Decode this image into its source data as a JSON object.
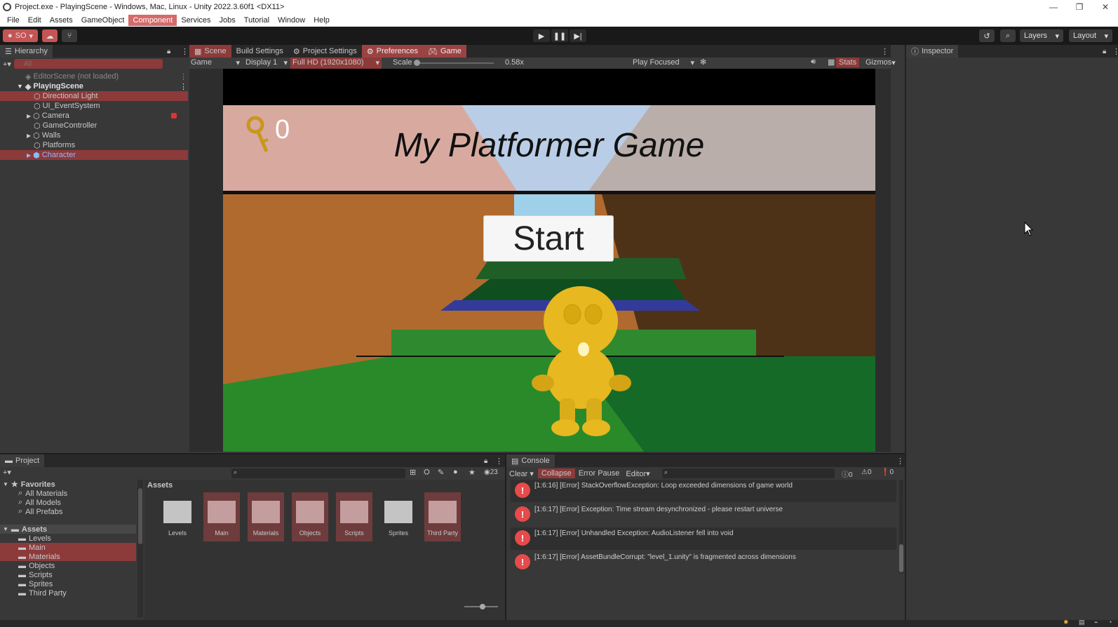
{
  "window": {
    "title": "Project.exe - PlayingScene - Windows, Mac, Linux - Unity 2022.3.60f1 <DX11>",
    "min": "—",
    "max": "❐",
    "close": "✕"
  },
  "menu": [
    "File",
    "Edit",
    "Assets",
    "GameObject",
    "Component",
    "Services",
    "Jobs",
    "Tutorial",
    "Window",
    "Help"
  ],
  "toolbar": {
    "account": "SO",
    "layers": "Layers",
    "layout": "Layout"
  },
  "hierarchy": {
    "tab": "Hierarchy",
    "search_placeholder": "All",
    "items": [
      "EditorScene (not loaded)",
      "PlayingScene",
      "Directional Light",
      "UI_EventSystem",
      "Camera",
      "GameController",
      "Walls",
      "Platforms",
      "Character"
    ]
  },
  "center_tabs": [
    "Scene",
    "Build Settings",
    "Project Settings",
    "Preferences",
    "Game"
  ],
  "game_bar": {
    "mode": "Game",
    "display": "Display 1",
    "resolution": "Full HD (1920x1080)",
    "scale_label": "Scale",
    "scale_value": "0.58x",
    "play_focused": "Play Focused",
    "stats": "Stats",
    "gizmos": "Gizmos"
  },
  "game": {
    "key_count": "0",
    "title": "My Platformer Game",
    "start": "Start"
  },
  "inspector": {
    "tab": "Inspector"
  },
  "project": {
    "tab": "Project",
    "count": "23",
    "favorites": "Favorites",
    "fav_items": [
      "All Materials",
      "All Models",
      "All Prefabs"
    ],
    "assets_root": "Assets",
    "asset_folders": [
      "Levels",
      "Main",
      "Materials",
      "Objects",
      "Scripts",
      "Sprites",
      "Third Party"
    ],
    "grid_header": "Assets"
  },
  "console": {
    "tab": "Console",
    "clear": "Clear",
    "collapse": "Collapse",
    "error_pause": "Error Pause",
    "editor": "Editor",
    "info_count": "0",
    "warn_count": "0",
    "err_count": "0",
    "messages": [
      "[1:6:16] [Error] StackOverflowException: Loop exceeded dimensions of game world",
      "[1:6:17] [Error] Exception: Time stream desynchronized - please restart universe",
      "[1:6:17] [Error] Unhandled Exception: AudioListener fell into void",
      "[1:6:17] [Error] AssetBundleCorrupt: \"level_1.unity\" is fragmented across dimensions"
    ]
  }
}
